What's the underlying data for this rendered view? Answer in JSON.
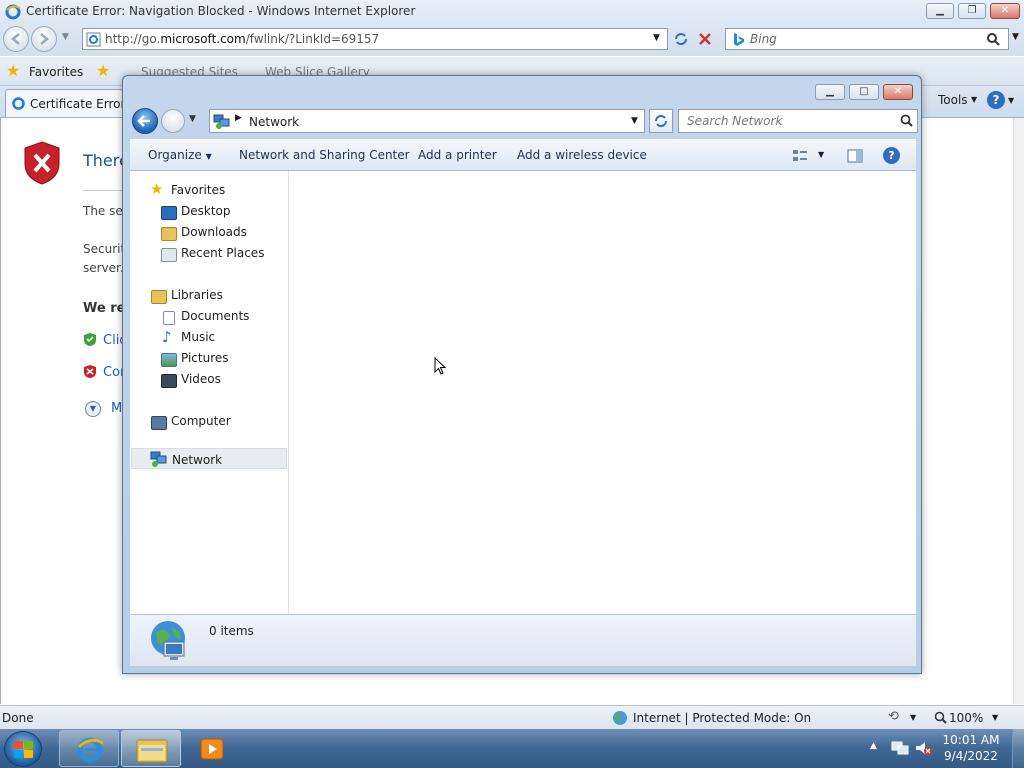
{
  "ie": {
    "title": "Certificate Error: Navigation Blocked - Windows Internet Explorer",
    "url_prefix": "http://go.",
    "url_domain": "microsoft.com",
    "url_rest": "/fwlink/?LinkId=69157",
    "search_placeholder": "Bing",
    "favorites_label": "Favorites",
    "suggested_sites": "Suggested Sites",
    "web_slice": "Web Slice Gallery",
    "tab_title": "Certificate Error: N",
    "tools_label": "Tools",
    "page_heading": "There",
    "page_text1": "The se",
    "page_text2": "Securit",
    "page_text3": "server.",
    "page_bold": "We re",
    "link1": "Clic",
    "link2": "Cor",
    "link3": "M",
    "status_left": "Done",
    "status_zone": "Internet | Protected Mode: On",
    "zoom": "100%"
  },
  "explorer": {
    "breadcrumb": "Network",
    "search_placeholder": "Search Network",
    "commands": [
      "Organize",
      "Network and Sharing Center",
      "Add a printer",
      "Add a wireless device"
    ],
    "nav": {
      "favorites": "Favorites",
      "desktop": "Desktop",
      "downloads": "Downloads",
      "recent": "Recent Places",
      "libraries": "Libraries",
      "documents": "Documents",
      "music": "Music",
      "pictures": "Pictures",
      "videos": "Videos",
      "computer": "Computer",
      "network": "Network"
    },
    "item_count": "0 items"
  },
  "taskbar": {
    "time": "10:01 AM",
    "date": "9/4/2022"
  }
}
